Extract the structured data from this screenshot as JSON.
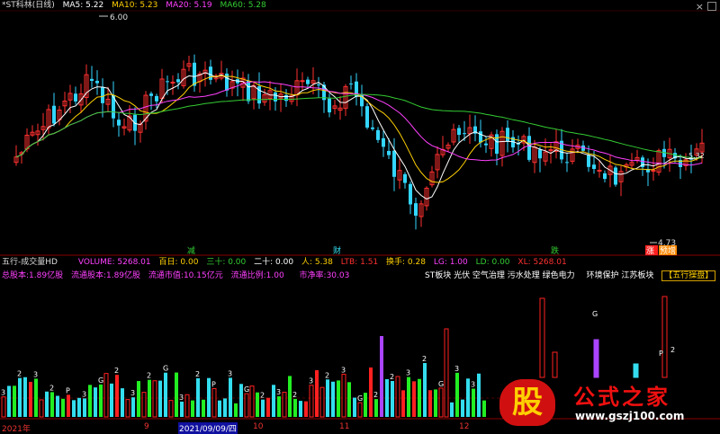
{
  "colors": {
    "up": "#ff3030",
    "down": "#33d6ff",
    "ma5": "#ffffff",
    "ma10": "#ffd000",
    "ma20": "#ff40ff",
    "ma60": "#33cc33",
    "grid": "#4a0000",
    "vol_red": "#ff2020",
    "vol_cyan": "#33ddee",
    "vol_green": "#22ee22",
    "vol_purple": "#aa44ff",
    "label": "#ffffff"
  },
  "price_panel": {
    "title": "*ST科林(日线)",
    "ma5": "MA5: 5.22",
    "ma10": "MA10: 5.23",
    "ma20": "MA20: 5.19",
    "ma60": "MA60: 5.28",
    "high_label": "6.00",
    "low_label": "4.73",
    "right_label": "5.32",
    "markers": {
      "jian": "减",
      "cai": "财",
      "die": "跌",
      "zhang": "涨",
      "yuzhang": "预增"
    }
  },
  "volume_panel": {
    "title": "五行-成交量HD",
    "volume": "VOLUME: 5268.01",
    "bairi": "百日: 0.00",
    "sanshi": "三十: 0.00",
    "ershi": "二十: 0.00",
    "ren": "人: 5.38",
    "ltb": "LTB: 1.51",
    "huanshou": "换手: 0.28",
    "lg": "LG: 1.00",
    "ld": "LD: 0.00",
    "xl": "XL: 5268.01",
    "zongguben": "总股本:1.89亿股",
    "liutongguben": "流通股本:1.89亿股",
    "liutongshizhi": "流通市值:10.15亿元",
    "liutongbili": "流通比例:1.00",
    "shijinglv": "市净率:30.03",
    "sectors": "ST板块 光伏 空气治理 污水处理 绿色电力",
    "sectors2": "环境保护 江苏板块",
    "wuxing_btn": "【五行操盘】"
  },
  "axis": {
    "dates": [
      "2021年",
      "9",
      "2021/09/09/四",
      "10",
      "11",
      "12"
    ]
  },
  "watermark": {
    "gu": "股",
    "title": "公式之家",
    "url": "www.gszj100.com"
  },
  "chart_data": {
    "type": "candlestick",
    "series": [
      {
        "name": "MA5",
        "values": [
          5.22
        ]
      },
      {
        "name": "MA10",
        "values": [
          5.23
        ]
      },
      {
        "name": "MA20",
        "values": [
          5.19
        ]
      },
      {
        "name": "MA60",
        "values": [
          5.28
        ]
      }
    ],
    "annotations": [
      "6.00",
      "4.73",
      "5.32"
    ],
    "ylim": [
      4.6,
      6.1
    ],
    "volume_labels": [
      "3",
      "2",
      "3",
      "2",
      "P",
      "3",
      "G",
      "2",
      "3",
      "2",
      "G",
      "3",
      "2",
      "P",
      "3",
      "G",
      "2",
      "3",
      "2",
      "3",
      "2",
      "3",
      "G",
      "2",
      "2",
      "3",
      "2",
      "G",
      "3",
      "3",
      "2",
      "G",
      "2",
      "3",
      "P",
      "2",
      "3"
    ]
  }
}
